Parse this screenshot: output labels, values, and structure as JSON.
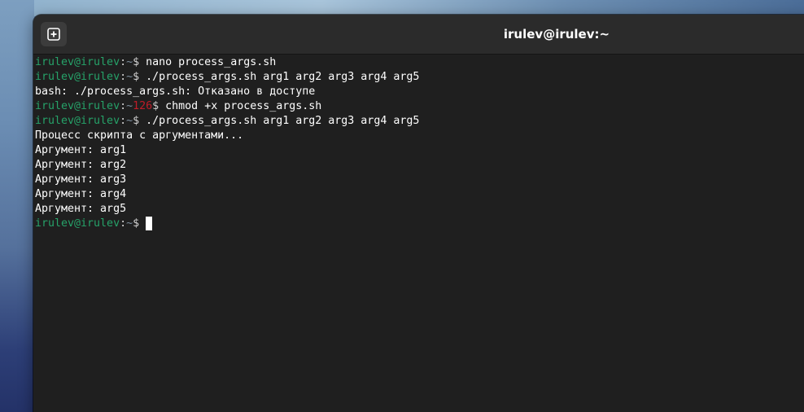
{
  "window": {
    "title": "irulev@irulev:~"
  },
  "titlebar": {
    "new_tab_icon": "new-tab-plus-icon"
  },
  "prompt": {
    "user_host": "irulev@irulev",
    "sep": ":",
    "path": "~",
    "symbol": "$ "
  },
  "terminal": {
    "lines": [
      {
        "type": "prompt",
        "command": "nano process_args.sh"
      },
      {
        "type": "prompt",
        "command": "./process_args.sh arg1 arg2 arg3 arg4 arg5"
      },
      {
        "type": "output",
        "text": "bash: ./process_args.sh: Отказано в доступе"
      },
      {
        "type": "prompt",
        "exit_code": "126",
        "command": "chmod +x process_args.sh"
      },
      {
        "type": "prompt",
        "command": "./process_args.sh arg1 arg2 arg3 arg4 arg5"
      },
      {
        "type": "output",
        "text": "Процесс скрипта с аргументами..."
      },
      {
        "type": "output",
        "text": "Аргумент: arg1"
      },
      {
        "type": "output",
        "text": "Аргумент: arg2"
      },
      {
        "type": "output",
        "text": "Аргумент: arg3"
      },
      {
        "type": "output",
        "text": "Аргумент: arg4"
      },
      {
        "type": "output",
        "text": "Аргумент: arg5"
      },
      {
        "type": "prompt",
        "command": "",
        "cursor": true
      }
    ]
  },
  "colors": {
    "prompt_user": "#26a269",
    "prompt_path": "#7f8f9f",
    "exit_code": "#c01c28",
    "terminal_bg": "#1f1f1f",
    "titlebar_bg": "#2b2b2b"
  }
}
